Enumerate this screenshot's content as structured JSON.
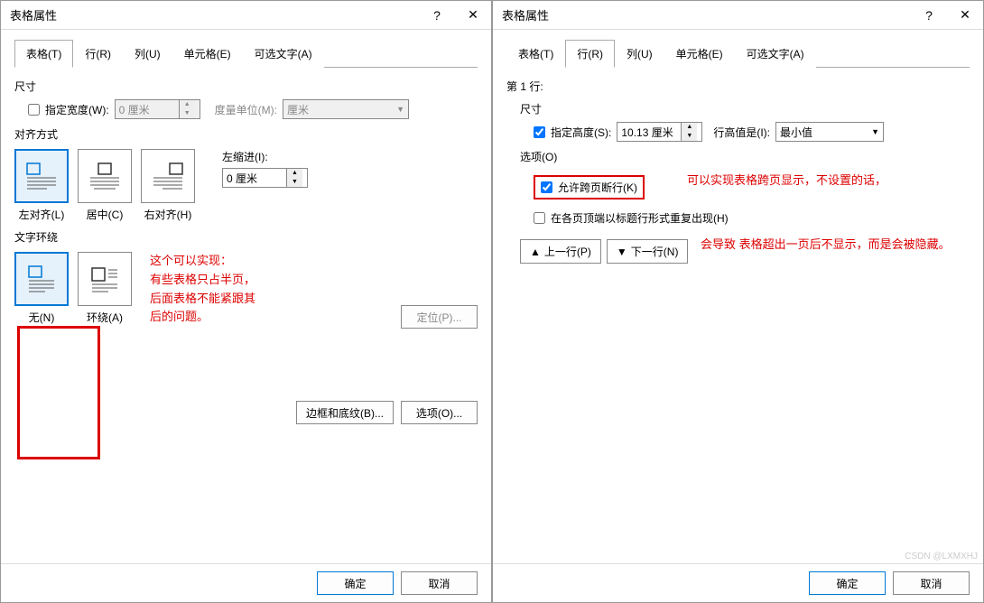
{
  "watermark": "CSDN @LXMXHJ",
  "left": {
    "title": "表格属性",
    "tabs": [
      "表格(T)",
      "行(R)",
      "列(U)",
      "单元格(E)",
      "可选文字(A)"
    ],
    "activeTab": 0,
    "size_label": "尺寸",
    "specify_width_label": "指定宽度(W):",
    "width_value": "0 厘米",
    "unit_label": "度量单位(M):",
    "unit_value": "厘米",
    "align_label": "对齐方式",
    "align_opts": [
      "左对齐(L)",
      "居中(C)",
      "右对齐(H)"
    ],
    "indent_label": "左缩进(I):",
    "indent_value": "0 厘米",
    "wrap_label": "文字环绕",
    "wrap_opts": [
      "无(N)",
      "环绕(A)"
    ],
    "position_btn": "定位(P)...",
    "borders_btn": "边框和底纹(B)...",
    "options_btn": "选项(O)...",
    "ok": "确定",
    "cancel": "取消",
    "annotation": "这个可以实现：\n有些表格只占半页，\n后面表格不能紧跟其\n后的问题。"
  },
  "right": {
    "title": "表格属性",
    "tabs": [
      "表格(T)",
      "行(R)",
      "列(U)",
      "单元格(E)",
      "可选文字(A)"
    ],
    "activeTab": 1,
    "row_header": "第 1 行:",
    "size_label": "尺寸",
    "specify_height_label": "指定高度(S):",
    "height_value": "10.13 厘米",
    "height_rule_label": "行高值是(I):",
    "height_rule_value": "最小值",
    "options_label": "选项(O)",
    "allow_break_label": "允许跨页断行(K)",
    "repeat_header_label": "在各页顶端以标题行形式重复出现(H)",
    "prev_row": "上一行(P)",
    "next_row": "下一行(N)",
    "ok": "确定",
    "cancel": "取消",
    "annotation1": "可以实现表格跨页显示，不设置的话，",
    "annotation2": "会导致 表格超出一页后不显示，而是会被隐藏。"
  }
}
